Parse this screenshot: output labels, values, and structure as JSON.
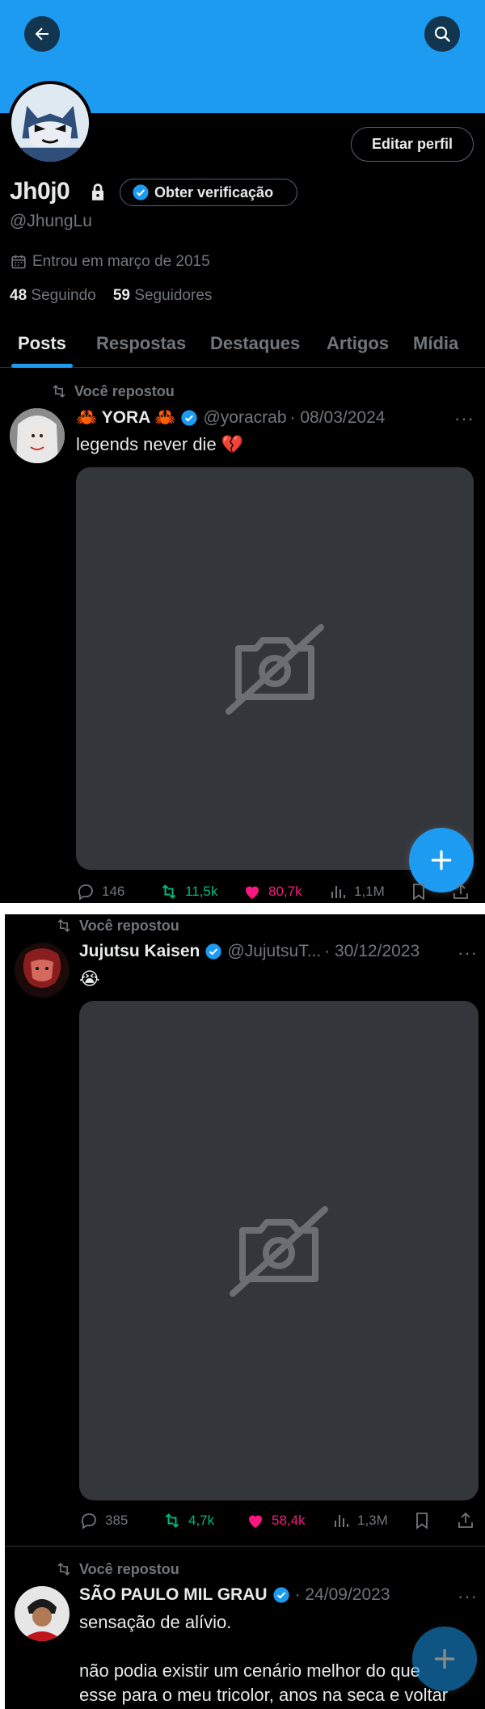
{
  "header": {
    "back_icon": "arrow-left-icon",
    "search_icon": "search-icon",
    "banner_color": "#1d9bf0"
  },
  "profile": {
    "name": "Jh0j0",
    "handle": "@JhungLu",
    "edit_label": "Editar perfil",
    "verify_label": "Obter verificação",
    "joined": "Entrou em março de 2015",
    "following_count": "48",
    "following_label": "Seguindo",
    "followers_count": "59",
    "followers_label": "Seguidores"
  },
  "tabs": [
    {
      "label": "Posts"
    },
    {
      "label": "Respostas"
    },
    {
      "label": "Destaques"
    },
    {
      "label": "Artigos"
    },
    {
      "label": "Mídia"
    }
  ],
  "posts": [
    {
      "repost_label": "Você repostou",
      "name": "🦀 YORA 🦀",
      "handle": "@yoracrab",
      "date": "· 08/03/2024",
      "text": "legends never die 💔",
      "replies": "146",
      "reposts": "11,5k",
      "likes": "80,7k",
      "views": "1,1M"
    },
    {
      "repost_label": "Você repostou",
      "name": "Jujutsu Kaisen",
      "handle": "@JujutsuT...",
      "date": "· 30/12/2023",
      "text": "😭",
      "replies": "385",
      "reposts": "4,7k",
      "likes": "58,4k",
      "views": "1,3M"
    },
    {
      "repost_label": "Você repostou",
      "name": "SÃO PAULO MIL GRAU",
      "handle": "",
      "date": "· 24/09/2023",
      "text": "sensação de alívio.",
      "text2": "não podia existir um cenário melhor do que",
      "text3": "esse para o meu tricolor, anos na seca e voltar"
    }
  ],
  "colors": {
    "accent": "#1d9bf0",
    "repost_green": "#00ba7c",
    "like_pink": "#f91880",
    "muted": "#71767b"
  }
}
